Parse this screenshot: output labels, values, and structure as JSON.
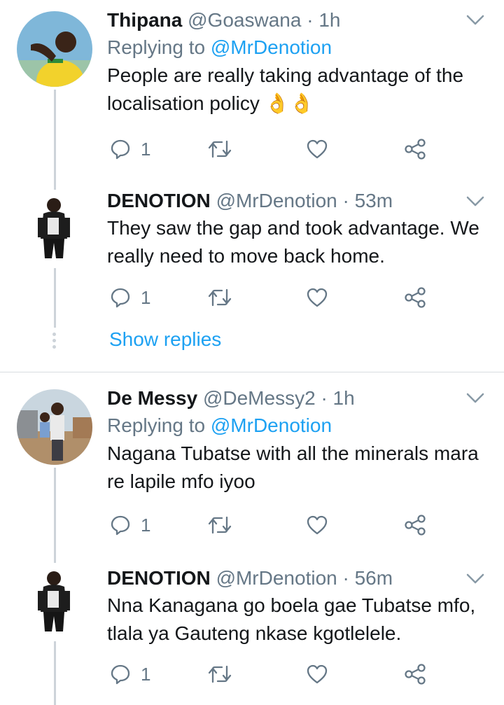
{
  "tweets": [
    {
      "name": "Thipana",
      "handle": "@Goaswana",
      "sep": "·",
      "time": "1h",
      "replying_prefix": "Replying to",
      "replying_to": "@MrDenotion",
      "text": "People are really taking advantage of the localisation policy 👌👌",
      "reply_count": "1"
    },
    {
      "name": "DENOTION",
      "handle": "@MrDenotion",
      "sep": "·",
      "time": "53m",
      "text": "They saw the gap and took advantage. We really need to move back home.",
      "reply_count": "1"
    },
    {
      "name": "De Messy",
      "handle": "@DeMessy2",
      "sep": "·",
      "time": "1h",
      "replying_prefix": "Replying to",
      "replying_to": "@MrDenotion",
      "text": "Nagana Tubatse with all the minerals mara re lapile mfo iyoo",
      "reply_count": "1"
    },
    {
      "name": "DENOTION",
      "handle": "@MrDenotion",
      "sep": "·",
      "time": "56m",
      "text": "Nna Kanagana go boela gae Tubatse mfo, tlala ya Gauteng nkase kgotlelele.",
      "reply_count": "1"
    }
  ],
  "show_replies_label": "Show replies",
  "colors": {
    "link": "#1da1f2",
    "secondary": "#657786",
    "thread_line": "#cdd3d9",
    "text": "#14171a"
  },
  "icons": [
    "reply-icon",
    "retweet-icon",
    "like-icon",
    "share-icon",
    "chevron-down-icon"
  ]
}
